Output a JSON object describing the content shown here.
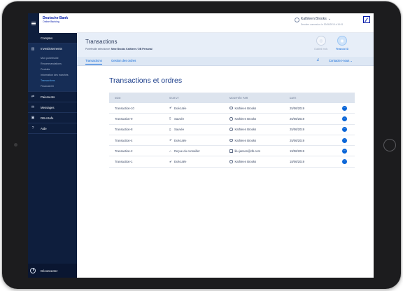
{
  "brand": {
    "name": "Deutsche Bank",
    "subtitle": "Online Banking"
  },
  "sidebar": {
    "items": [
      {
        "label": "Comptes",
        "icon": ""
      },
      {
        "label": "Investissements",
        "icon": "chart-icon",
        "subitems": [
          "Mon portefeuille",
          "Recommandations",
          "Produits",
          "Information des marchés",
          "Transactions",
          "Financial ID"
        ],
        "current": "Transactions"
      },
      {
        "label": "Paiements",
        "icon": "transfer-icon"
      },
      {
        "label": "Messages",
        "icon": "messages-icon"
      },
      {
        "label": "DB eSafe",
        "icon": "safe-icon"
      },
      {
        "label": "Aide",
        "icon": "help-icon"
      }
    ],
    "logout": "Déconnecter"
  },
  "topbar": {
    "user_name": "Kathleen Brooks",
    "last_login": "Dernière connexion: le 30/06/2019 à 18:01"
  },
  "header": {
    "title": "Transactions",
    "subtitle_prefix": "Portefeuille sélectionné:",
    "subtitle_value": "Mme Brooks Kathleen / DB Personal",
    "badges": [
      {
        "label": "Guided mob.",
        "icon": "guided-icon",
        "color": "#c9d3e3"
      },
      {
        "label": "Financial ID",
        "icon": "fingerprint-icon",
        "color": "#0a66d8"
      }
    ]
  },
  "tabs": [
    {
      "label": "Transactions",
      "active": true
    },
    {
      "label": "Gestion des ordres",
      "active": false
    }
  ],
  "contact": "Contactez-nous",
  "main": {
    "title": "Transactions et ordres",
    "columns": [
      "NOM",
      "STATUT",
      "MODIFIÉE PAR",
      "DATE"
    ],
    "rows": [
      {
        "name": "Transaction-10",
        "status": "Exécutée",
        "status_icon": "check-icon",
        "by": "Kathleen Brooks",
        "by_icon": "user-icon",
        "date": "25/06/2019"
      },
      {
        "name": "Transaction-9",
        "status": "Sauvée",
        "status_icon": "doc-icon",
        "by": "Kathleen Brooks",
        "by_icon": "user-icon",
        "date": "25/06/2019"
      },
      {
        "name": "Transaction-8",
        "status": "Sauvée",
        "status_icon": "doc-icon",
        "by": "Kathleen Brooks",
        "by_icon": "user-icon",
        "date": "25/06/2019"
      },
      {
        "name": "Transaction-4",
        "status": "Exécutée",
        "status_icon": "check-icon",
        "by": "Kathleen Brooks",
        "by_icon": "user-icon",
        "date": "25/06/2019"
      },
      {
        "name": "Transaction-2",
        "status": "Reçue du conseiller",
        "status_icon": "inbox-icon",
        "by": "lilu.jansen@db.com",
        "by_icon": "mail-icon",
        "date": "19/06/2019"
      },
      {
        "name": "Transaction-1",
        "status": "Exécutée",
        "status_icon": "check-icon",
        "by": "Kathleen Brooks",
        "by_icon": "user-icon",
        "date": "18/06/2019"
      }
    ]
  }
}
